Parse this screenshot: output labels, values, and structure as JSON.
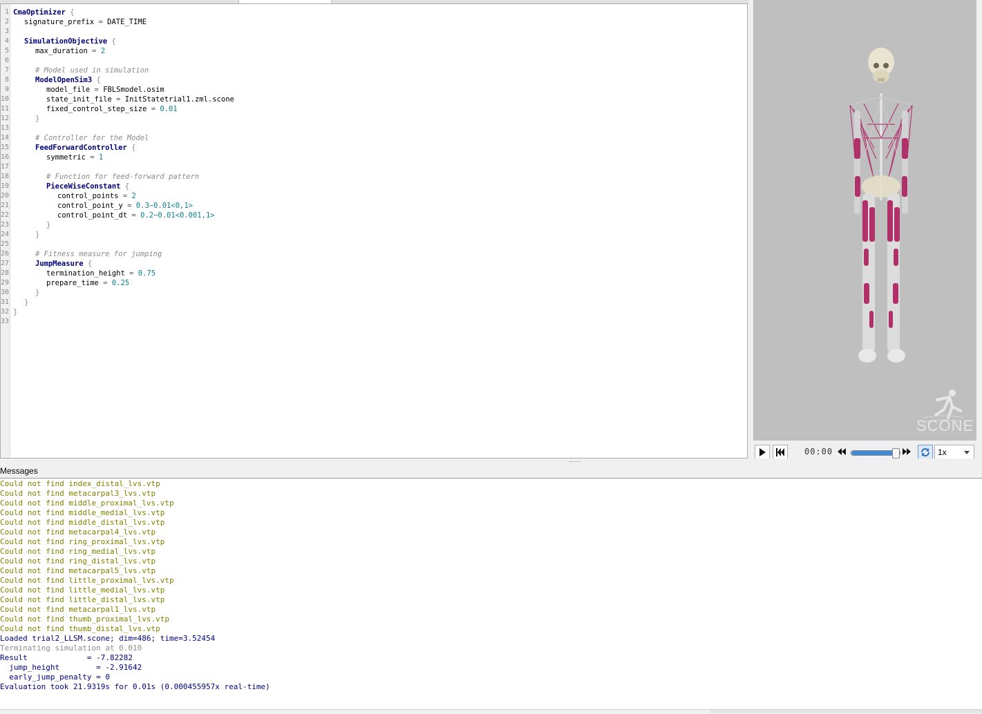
{
  "editor": {
    "lines": [
      {
        "n": "1",
        "indent": 0,
        "parts": [
          {
            "t": "CmaOptimizer",
            "c": "kw"
          },
          {
            "t": " {",
            "c": "br"
          }
        ]
      },
      {
        "n": "2",
        "indent": 1,
        "parts": [
          {
            "t": "signature_prefix",
            "c": ""
          },
          {
            "t": " = ",
            "c": "op"
          },
          {
            "t": "DATE_TIME",
            "c": ""
          }
        ]
      },
      {
        "n": "3",
        "indent": 0,
        "parts": []
      },
      {
        "n": "4",
        "indent": 1,
        "parts": [
          {
            "t": "SimulationObjective",
            "c": "kw"
          },
          {
            "t": " {",
            "c": "br"
          }
        ]
      },
      {
        "n": "5",
        "indent": 2,
        "parts": [
          {
            "t": "max_duration",
            "c": ""
          },
          {
            "t": " = ",
            "c": "op"
          },
          {
            "t": "2",
            "c": "num"
          }
        ]
      },
      {
        "n": "6",
        "indent": 0,
        "parts": []
      },
      {
        "n": "7",
        "indent": 2,
        "parts": [
          {
            "t": "# Model used in simulation",
            "c": "cm"
          }
        ]
      },
      {
        "n": "8",
        "indent": 2,
        "parts": [
          {
            "t": "ModelOpenSim3",
            "c": "kw"
          },
          {
            "t": " {",
            "c": "br"
          }
        ]
      },
      {
        "n": "9",
        "indent": 3,
        "parts": [
          {
            "t": "model_file",
            "c": ""
          },
          {
            "t": " = ",
            "c": "op"
          },
          {
            "t": "FBLSmodel.osim",
            "c": ""
          }
        ]
      },
      {
        "n": "10",
        "indent": 3,
        "parts": [
          {
            "t": "state_init_file",
            "c": ""
          },
          {
            "t": " = ",
            "c": "op"
          },
          {
            "t": "InitStatetrial1.zml.scone",
            "c": ""
          }
        ]
      },
      {
        "n": "11",
        "indent": 3,
        "parts": [
          {
            "t": "fixed_control_step_size",
            "c": ""
          },
          {
            "t": " = ",
            "c": "op"
          },
          {
            "t": "0.01",
            "c": "num"
          }
        ]
      },
      {
        "n": "12",
        "indent": 2,
        "parts": [
          {
            "t": "}",
            "c": "br"
          }
        ]
      },
      {
        "n": "13",
        "indent": 0,
        "parts": []
      },
      {
        "n": "14",
        "indent": 2,
        "parts": [
          {
            "t": "# Controller for the Model",
            "c": "cm"
          }
        ]
      },
      {
        "n": "15",
        "indent": 2,
        "parts": [
          {
            "t": "FeedForwardController",
            "c": "kw"
          },
          {
            "t": " {",
            "c": "br"
          }
        ]
      },
      {
        "n": "16",
        "indent": 3,
        "parts": [
          {
            "t": "symmetric",
            "c": ""
          },
          {
            "t": " = ",
            "c": "op"
          },
          {
            "t": "1",
            "c": "num"
          }
        ]
      },
      {
        "n": "17",
        "indent": 0,
        "parts": []
      },
      {
        "n": "18",
        "indent": 3,
        "parts": [
          {
            "t": "# Function for feed-forward pattern",
            "c": "cm"
          }
        ]
      },
      {
        "n": "19",
        "indent": 3,
        "parts": [
          {
            "t": "PieceWiseConstant",
            "c": "kw"
          },
          {
            "t": " {",
            "c": "br"
          }
        ]
      },
      {
        "n": "20",
        "indent": 4,
        "parts": [
          {
            "t": "control_points",
            "c": ""
          },
          {
            "t": " = ",
            "c": "op"
          },
          {
            "t": "2",
            "c": "num"
          }
        ]
      },
      {
        "n": "21",
        "indent": 4,
        "parts": [
          {
            "t": "control_point_y",
            "c": ""
          },
          {
            "t": " = ",
            "c": "op"
          },
          {
            "t": "0.3~0.01<0,1>",
            "c": "num"
          }
        ]
      },
      {
        "n": "22",
        "indent": 4,
        "parts": [
          {
            "t": "control_point_dt",
            "c": ""
          },
          {
            "t": " = ",
            "c": "op"
          },
          {
            "t": "0.2~0.01<0.001,1>",
            "c": "num"
          }
        ]
      },
      {
        "n": "23",
        "indent": 3,
        "parts": [
          {
            "t": "}",
            "c": "br"
          }
        ]
      },
      {
        "n": "24",
        "indent": 2,
        "parts": [
          {
            "t": "}",
            "c": "br"
          }
        ]
      },
      {
        "n": "25",
        "indent": 0,
        "parts": []
      },
      {
        "n": "26",
        "indent": 2,
        "parts": [
          {
            "t": "# Fitness measure for jumping",
            "c": "cm"
          }
        ]
      },
      {
        "n": "27",
        "indent": 2,
        "parts": [
          {
            "t": "JumpMeasure",
            "c": "kw"
          },
          {
            "t": " {",
            "c": "br"
          }
        ]
      },
      {
        "n": "28",
        "indent": 3,
        "parts": [
          {
            "t": "termination_height",
            "c": ""
          },
          {
            "t": " = ",
            "c": "op"
          },
          {
            "t": "0.75",
            "c": "num"
          }
        ]
      },
      {
        "n": "29",
        "indent": 3,
        "parts": [
          {
            "t": "prepare_time",
            "c": ""
          },
          {
            "t": " = ",
            "c": "op"
          },
          {
            "t": "0.25",
            "c": "num"
          }
        ]
      },
      {
        "n": "30",
        "indent": 2,
        "parts": [
          {
            "t": "}",
            "c": "br"
          }
        ]
      },
      {
        "n": "31",
        "indent": 1,
        "parts": [
          {
            "t": "}",
            "c": "br"
          }
        ]
      },
      {
        "n": "32",
        "indent": 0,
        "parts": [
          {
            "t": "}",
            "c": "br"
          }
        ]
      },
      {
        "n": "33",
        "indent": 0,
        "parts": []
      }
    ]
  },
  "viewer": {
    "logo_text": "SCONE",
    "background": "#bfbfbf"
  },
  "playback": {
    "play_icon": "play-icon",
    "restart_icon": "skip-to-start-icon",
    "time": "00:00",
    "rewind_icon": "rewind-icon",
    "position": 0.92,
    "ffwd_icon": "fast-forward-icon",
    "loop_icon": "loop-icon",
    "speed": "1x"
  },
  "messages": {
    "title": "Messages",
    "lines": [
      {
        "text": "Could not find index_distal_lvs.vtp",
        "level": "warn"
      },
      {
        "text": "Could not find metacarpal3_lvs.vtp",
        "level": "warn"
      },
      {
        "text": "Could not find middle_proximal_lvs.vtp",
        "level": "warn"
      },
      {
        "text": "Could not find middle_medial_lvs.vtp",
        "level": "warn"
      },
      {
        "text": "Could not find middle_distal_lvs.vtp",
        "level": "warn"
      },
      {
        "text": "Could not find metacarpal4_lvs.vtp",
        "level": "warn"
      },
      {
        "text": "Could not find ring_proximal_lvs.vtp",
        "level": "warn"
      },
      {
        "text": "Could not find ring_medial_lvs.vtp",
        "level": "warn"
      },
      {
        "text": "Could not find ring_distal_lvs.vtp",
        "level": "warn"
      },
      {
        "text": "Could not find metacarpal5_lvs.vtp",
        "level": "warn"
      },
      {
        "text": "Could not find little_proximal_lvs.vtp",
        "level": "warn"
      },
      {
        "text": "Could not find little_medial_lvs.vtp",
        "level": "warn"
      },
      {
        "text": "Could not find little_distal_lvs.vtp",
        "level": "warn"
      },
      {
        "text": "Could not find metacarpal1_lvs.vtp",
        "level": "warn"
      },
      {
        "text": "Could not find thumb_proximal_lvs.vtp",
        "level": "warn"
      },
      {
        "text": "Could not find thumb_distal_lvs.vtp",
        "level": "warn"
      },
      {
        "text": "Loaded trial2_LLSM.scone; dim=486; time=3.52454",
        "level": "info"
      },
      {
        "text": "Terminating simulation at 0.010",
        "level": "trace"
      },
      {
        "text": "Result             = -7.82282",
        "level": "info"
      },
      {
        "text": "  jump_height        = -2.91642",
        "level": "info"
      },
      {
        "text": "  early_jump_penalty = 0",
        "level": "info"
      },
      {
        "text": "Evaluation took 21.9319s for 0.01s (0.000455957x real-time)",
        "level": "info"
      }
    ]
  }
}
